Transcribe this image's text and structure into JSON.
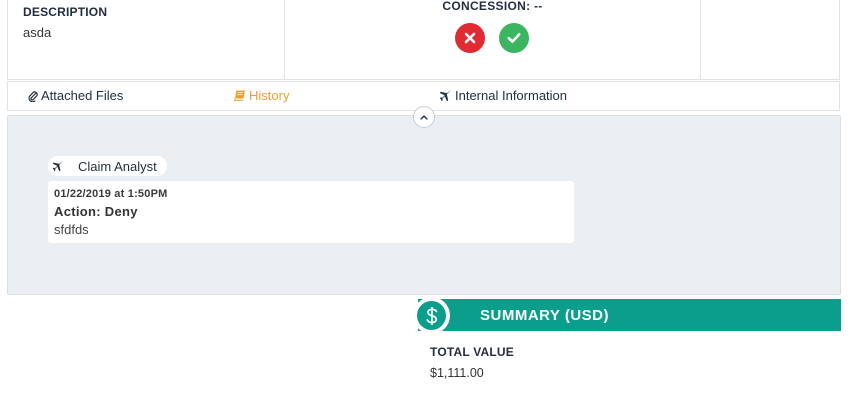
{
  "description": {
    "label": "DESCRIPTION",
    "value": "asda"
  },
  "concession": {
    "label": "CONCESSION: --",
    "reject_icon": "x-icon",
    "accept_icon": "check-icon",
    "reject_color": "#e02b35",
    "accept_color": "#3bb55f"
  },
  "tabs": [
    {
      "label": "Attached Files",
      "icon": "paperclip-icon"
    },
    {
      "label": "History",
      "icon": "book-icon",
      "active": true
    },
    {
      "label": "Internal Information",
      "icon": "plane-icon"
    }
  ],
  "history": {
    "actor": "Claim Analyst",
    "actor_icon": "plane-icon",
    "entries": [
      {
        "date": "01/22/2019 at 1:50PM",
        "action": "Action: Deny",
        "note": "sfdfds"
      }
    ]
  },
  "summary": {
    "title": "SUMMARY (USD)",
    "icon": "dollar-icon",
    "accent": "#0b9e8c",
    "total_label": "TOTAL VALUE",
    "total_value": "$1,111.00"
  },
  "colors": {
    "active_tab": "#f0a030",
    "panel_bg": "#eceff2"
  }
}
